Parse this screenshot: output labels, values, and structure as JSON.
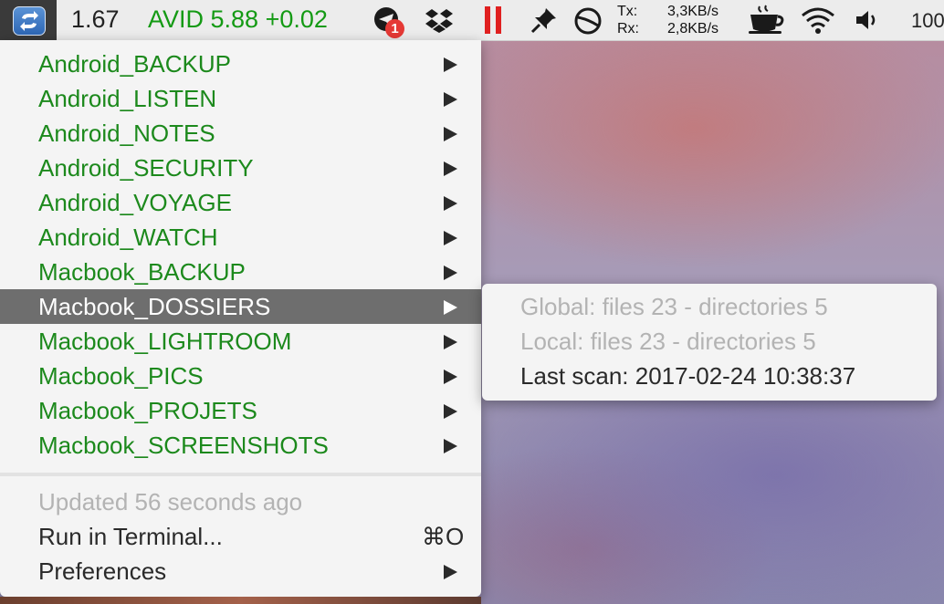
{
  "menubar": {
    "version": "1.67",
    "ticker": "AVID 5.88 +0.02",
    "badge_count": "1",
    "net_tx_label": "Tx:",
    "net_tx_value": "3,3KB/s",
    "net_rx_label": "Rx:",
    "net_rx_value": "2,8KB/s",
    "battery_partial": "100",
    "icons": [
      "app-sync-icon",
      "telegram-icon",
      "dropbox-icon",
      "pause-icon",
      "pin-icon",
      "circle-icon",
      "coffee-icon",
      "wifi-icon",
      "volume-icon"
    ],
    "colors": {
      "ticker": "#149a14",
      "pause": "#e02020",
      "badge": "#e53935"
    }
  },
  "menu": {
    "items": [
      {
        "label": "Android_BACKUP"
      },
      {
        "label": "Android_LISTEN"
      },
      {
        "label": "Android_NOTES"
      },
      {
        "label": "Android_SECURITY"
      },
      {
        "label": "Android_VOYAGE"
      },
      {
        "label": "Android_WATCH"
      },
      {
        "label": "Macbook_BACKUP"
      },
      {
        "label": "Macbook_DOSSIERS"
      },
      {
        "label": "Macbook_LIGHTROOM"
      },
      {
        "label": "Macbook_PICS"
      },
      {
        "label": "Macbook_PROJETS"
      },
      {
        "label": "Macbook_SCREENSHOTS"
      }
    ],
    "selected_index": 7,
    "updated": "Updated 56 seconds ago",
    "run_terminal": "Run in Terminal...",
    "run_terminal_shortcut": "⌘O",
    "preferences": "Preferences"
  },
  "submenu": {
    "global": "Global: files 23 - directories 5",
    "local": "Local: files 23 - directories 5",
    "last_scan": "Last scan: 2017-02-24 10:38:37"
  }
}
